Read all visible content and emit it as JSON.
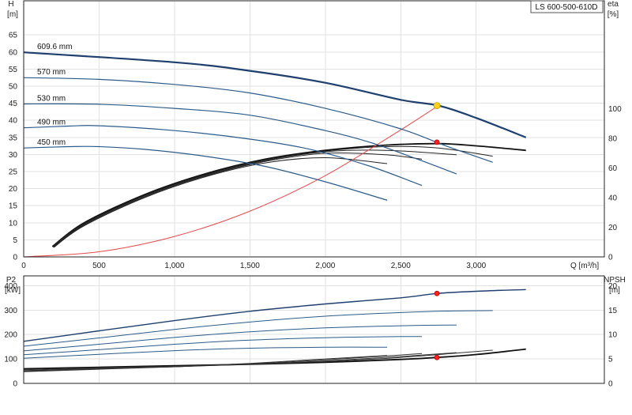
{
  "model_label": "LS 600-500-610D",
  "chart_data": [
    {
      "type": "line",
      "name": "head-efficiency",
      "y_left_label": [
        "H",
        "[m]"
      ],
      "y_right_label": [
        "eta",
        "[%]"
      ],
      "x_label": "Q [m³/h]",
      "xlim": [
        0,
        3850
      ],
      "ylim": [
        0,
        75
      ],
      "x_ticks": [
        0,
        500,
        1000,
        1500,
        2000,
        2500,
        3000
      ],
      "x_tick_labels": [
        "0",
        "500",
        "1,000",
        "1,500",
        "2,000",
        "2,500",
        "3,000"
      ],
      "y_ticks": [
        0,
        5,
        10,
        15,
        20,
        25,
        30,
        35,
        40,
        45,
        50,
        55,
        60,
        65
      ],
      "y_right_ticks": [
        0,
        20,
        40,
        60,
        80,
        100
      ],
      "eta_scale_max": 173,
      "grid": true,
      "series": [
        {
          "name": "609.6 mm",
          "color": "#1f3f6e",
          "width": 2.2,
          "x": [
            0,
            1000,
            1500,
            2000,
            2500,
            2750,
            3000,
            3330
          ],
          "y": [
            59.9,
            57.0,
            54.5,
            51.0,
            46.0,
            44.3,
            40.7,
            35.0
          ]
        },
        {
          "name": "570 mm",
          "color": "#2b5b8a",
          "width": 1.2,
          "x": [
            0,
            500,
            1000,
            1500,
            2000,
            2500,
            2800,
            3110
          ],
          "y": [
            52.5,
            52.0,
            50.5,
            48.0,
            43.5,
            37.5,
            32.5,
            27.7
          ]
        },
        {
          "name": "530 mm",
          "color": "#2b5b8a",
          "width": 1.2,
          "x": [
            0,
            500,
            1000,
            1500,
            2000,
            2300,
            2600,
            2870
          ],
          "y": [
            44.8,
            44.7,
            43.5,
            41.5,
            37.0,
            33.5,
            28.8,
            24.3
          ]
        },
        {
          "name": "490 mm",
          "color": "#2b5b8a",
          "width": 1.2,
          "x": [
            0,
            300,
            500,
            1000,
            1500,
            1900,
            2300,
            2640
          ],
          "y": [
            37.8,
            38.3,
            38.4,
            37.0,
            34.5,
            31.5,
            26.5,
            20.9
          ]
        },
        {
          "name": "450 mm",
          "color": "#2b5b8a",
          "width": 1.2,
          "x": [
            0,
            300,
            500,
            800,
            1200,
            1600,
            2000,
            2410
          ],
          "y": [
            31.9,
            32.3,
            32.3,
            31.5,
            29.5,
            26.5,
            22.0,
            16.6
          ]
        }
      ],
      "eta_series": [
        {
          "color": "#111111",
          "width": 1.8,
          "x": [
            190,
            400,
            800,
            1200,
            1600,
            2000,
            2400,
            2750,
            3000,
            3330
          ],
          "eta": [
            7,
            23,
            42,
            56,
            66,
            72,
            75.5,
            76.5,
            75,
            72
          ]
        },
        {
          "color": "#222222",
          "width": 1.0,
          "x": [
            190,
            400,
            800,
            1200,
            1600,
            2000,
            2400,
            2750,
            3110
          ],
          "eta": [
            7,
            22.5,
            41.5,
            55.5,
            65.5,
            71.5,
            74.5,
            73.5,
            68
          ]
        },
        {
          "color": "#222222",
          "width": 1.0,
          "x": [
            195,
            400,
            800,
            1200,
            1600,
            2000,
            2400,
            2870
          ],
          "eta": [
            6.5,
            22,
            41,
            55,
            65,
            71,
            72,
            69
          ]
        },
        {
          "color": "#222222",
          "width": 1.0,
          "x": [
            200,
            400,
            800,
            1200,
            1600,
            2000,
            2400,
            2640
          ],
          "eta": [
            6.5,
            21.5,
            40.5,
            54.5,
            64.5,
            70,
            69,
            66
          ]
        },
        {
          "color": "#222222",
          "width": 1.0,
          "x": [
            200,
            400,
            800,
            1200,
            1600,
            2000,
            2410
          ],
          "eta": [
            6.5,
            21,
            40,
            54,
            63.5,
            67,
            63
          ]
        }
      ],
      "system_curve": {
        "color": "#e84a4a",
        "x": [
          0,
          500,
          1000,
          1500,
          2000,
          2500,
          2750
        ],
        "y": [
          0,
          1.5,
          6.0,
          13.4,
          23.8,
          37.2,
          44.3
        ]
      },
      "markers": [
        {
          "label": "duty-point",
          "x": 2740,
          "y": 44.3,
          "color": "#ffd21a",
          "stroke": "#c49a00",
          "r": 4
        },
        {
          "label": "efficiency-point",
          "x": 2740,
          "eta": 77.5,
          "color": "#ff2020",
          "stroke": "#aa0000",
          "r": 3
        }
      ]
    },
    {
      "type": "line",
      "name": "power-npsh",
      "y_left_label": [
        "P2",
        "[kW]"
      ],
      "y_right_label": [
        "NPSH",
        "[m]"
      ],
      "xlim": [
        0,
        3850
      ],
      "ylim": [
        0,
        440
      ],
      "y_ticks": [
        0,
        100,
        200,
        300,
        400
      ],
      "y_right_ticks": [
        0,
        5,
        10,
        15,
        20
      ],
      "npsh_scale_max": 22,
      "grid": true,
      "series": [
        {
          "name": "609.6 mm",
          "color": "#1f3f6e",
          "width": 1.4,
          "x": [
            0,
            500,
            1000,
            1500,
            2000,
            2500,
            2740,
            3000,
            3330
          ],
          "y": [
            172,
            215,
            257,
            295,
            325,
            350,
            368,
            377,
            384
          ]
        },
        {
          "name": "570 mm",
          "color": "#2b5b8a",
          "width": 1.0,
          "x": [
            0,
            500,
            1000,
            1500,
            2000,
            2500,
            2800,
            3110
          ],
          "y": [
            152,
            186,
            221,
            251,
            275,
            290,
            296,
            298
          ]
        },
        {
          "name": "530 mm",
          "color": "#2b5b8a",
          "width": 1.0,
          "x": [
            0,
            500,
            1000,
            1500,
            2000,
            2500,
            2870
          ],
          "y": [
            133,
            160,
            188,
            211,
            227,
            236,
            239
          ]
        },
        {
          "name": "490 mm",
          "color": "#2b5b8a",
          "width": 1.0,
          "x": [
            0,
            500,
            1000,
            1500,
            2000,
            2400,
            2640
          ],
          "y": [
            117,
            138,
            160,
            177,
            187,
            191,
            192
          ]
        },
        {
          "name": "450 mm",
          "color": "#2b5b8a",
          "width": 1.0,
          "x": [
            0,
            500,
            1000,
            1500,
            2000,
            2410
          ],
          "y": [
            103,
            119,
            134,
            144,
            148,
            148
          ]
        }
      ],
      "npsh_series": [
        {
          "color": "#111111",
          "width": 1.8,
          "x": [
            0,
            500,
            1000,
            1500,
            2000,
            2500,
            2740,
            3000,
            3330
          ],
          "npsh": [
            3.0,
            3.3,
            3.6,
            3.9,
            4.3,
            4.9,
            5.3,
            5.9,
            7.0
          ]
        },
        {
          "color": "#333333",
          "width": 1.0,
          "x": [
            0,
            500,
            1000,
            1500,
            2000,
            2500,
            3110
          ],
          "npsh": [
            2.8,
            3.2,
            3.5,
            3.9,
            4.5,
            5.3,
            6.8
          ]
        },
        {
          "color": "#333333",
          "width": 1.0,
          "x": [
            0,
            500,
            1000,
            1500,
            2000,
            2500,
            2870
          ],
          "npsh": [
            2.6,
            3.1,
            3.4,
            3.9,
            4.6,
            5.5,
            6.3
          ]
        },
        {
          "color": "#333333",
          "width": 1.0,
          "x": [
            0,
            500,
            1000,
            1500,
            2000,
            2400,
            2640
          ],
          "npsh": [
            2.5,
            3.0,
            3.4,
            4.0,
            4.8,
            5.6,
            6.1
          ]
        },
        {
          "color": "#333333",
          "width": 1.0,
          "x": [
            0,
            500,
            1000,
            1500,
            2000,
            2410
          ],
          "npsh": [
            2.4,
            2.9,
            3.4,
            4.1,
            5.0,
            5.7
          ]
        }
      ],
      "markers": [
        {
          "label": "power-point",
          "x": 2740,
          "y": 368,
          "color": "#ff2020",
          "stroke": "#aa0000",
          "r": 3
        },
        {
          "label": "npsh-point",
          "x": 2740,
          "npsh": 5.3,
          "color": "#ff2020",
          "stroke": "#aa0000",
          "r": 3
        }
      ]
    }
  ]
}
